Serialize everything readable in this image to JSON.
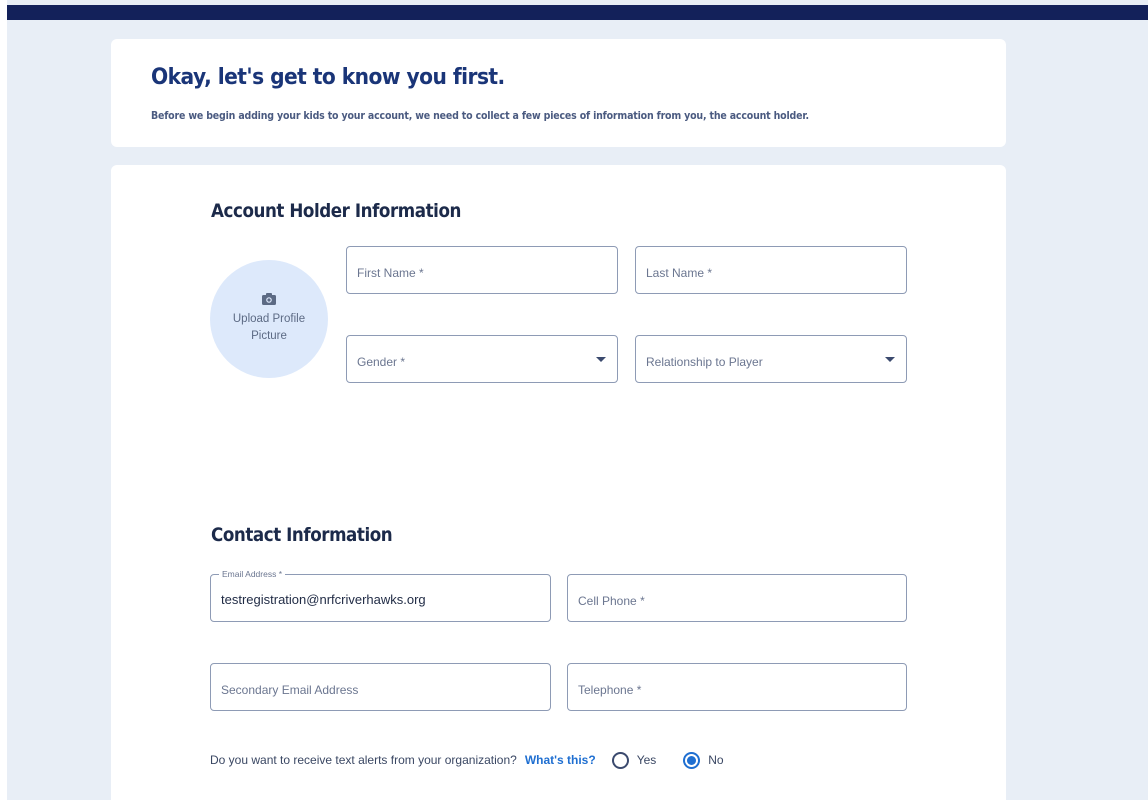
{
  "intro": {
    "title": "Okay, let's get to know you first.",
    "subtitle": "Before we begin adding your kids to your account, we need to collect a few pieces of information from you, the account holder."
  },
  "account_holder": {
    "section_title": "Account Holder Information",
    "avatar": {
      "icon": "camera-icon",
      "label": "Upload Profile Picture"
    },
    "first_name": {
      "placeholder": "First Name",
      "required": "*"
    },
    "last_name": {
      "placeholder": "Last Name",
      "required": "*"
    },
    "gender": {
      "placeholder": "Gender",
      "required": "*",
      "icon": "caret-down-icon"
    },
    "relationship": {
      "placeholder": "Relationship to Player",
      "icon": "caret-down-icon"
    }
  },
  "contact": {
    "section_title": "Contact Information",
    "email": {
      "label": "Email Address",
      "required": "*",
      "value": "testregistration@nrfcriverhawks.org"
    },
    "cell_phone": {
      "placeholder": "Cell Phone",
      "required": "*"
    },
    "secondary_email": {
      "placeholder": "Secondary Email Address"
    },
    "telephone": {
      "placeholder": "Telephone",
      "required": "*"
    },
    "text_alerts": {
      "question": "Do you want to receive text alerts from your organization?",
      "help_link": "What's this?",
      "options": [
        {
          "label": "Yes",
          "selected": false
        },
        {
          "label": "No",
          "selected": true
        }
      ]
    }
  },
  "colors": {
    "header_bar": "#13215a",
    "title": "#1a3578",
    "link": "#1f6fd1",
    "background": "#e8eef6",
    "avatar_bg": "#dde9fb"
  }
}
